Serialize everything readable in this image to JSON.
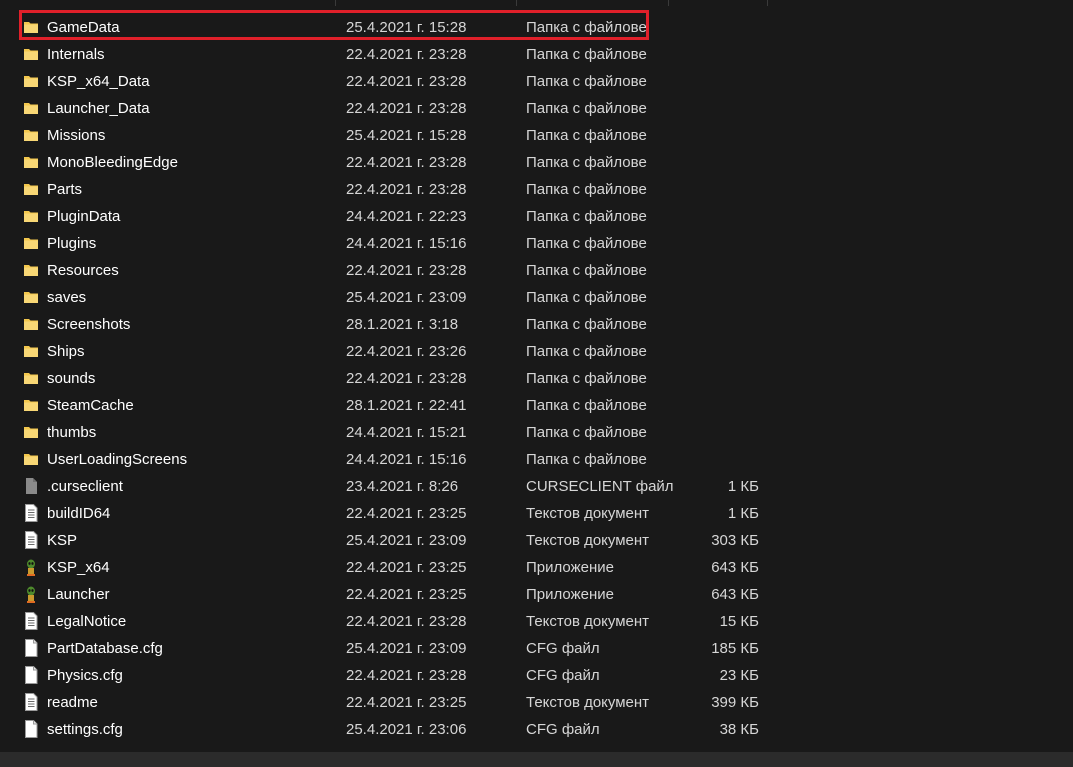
{
  "files": [
    {
      "name": "GameData",
      "date": "25.4.2021 г. 15:28",
      "type": "Папка с файлове",
      "size": "",
      "icon": "folder-icon"
    },
    {
      "name": "Internals",
      "date": "22.4.2021 г. 23:28",
      "type": "Папка с файлове",
      "size": "",
      "icon": "folder-icon"
    },
    {
      "name": "KSP_x64_Data",
      "date": "22.4.2021 г. 23:28",
      "type": "Папка с файлове",
      "size": "",
      "icon": "folder-icon"
    },
    {
      "name": "Launcher_Data",
      "date": "22.4.2021 г. 23:28",
      "type": "Папка с файлове",
      "size": "",
      "icon": "folder-icon"
    },
    {
      "name": "Missions",
      "date": "25.4.2021 г. 15:28",
      "type": "Папка с файлове",
      "size": "",
      "icon": "folder-icon"
    },
    {
      "name": "MonoBleedingEdge",
      "date": "22.4.2021 г. 23:28",
      "type": "Папка с файлове",
      "size": "",
      "icon": "folder-icon"
    },
    {
      "name": "Parts",
      "date": "22.4.2021 г. 23:28",
      "type": "Папка с файлове",
      "size": "",
      "icon": "folder-icon"
    },
    {
      "name": "PluginData",
      "date": "24.4.2021 г. 22:23",
      "type": "Папка с файлове",
      "size": "",
      "icon": "folder-icon"
    },
    {
      "name": "Plugins",
      "date": "24.4.2021 г. 15:16",
      "type": "Папка с файлове",
      "size": "",
      "icon": "folder-icon"
    },
    {
      "name": "Resources",
      "date": "22.4.2021 г. 23:28",
      "type": "Папка с файлове",
      "size": "",
      "icon": "folder-icon"
    },
    {
      "name": "saves",
      "date": "25.4.2021 г. 23:09",
      "type": "Папка с файлове",
      "size": "",
      "icon": "folder-icon"
    },
    {
      "name": "Screenshots",
      "date": "28.1.2021 г. 3:18",
      "type": "Папка с файлове",
      "size": "",
      "icon": "folder-icon"
    },
    {
      "name": "Ships",
      "date": "22.4.2021 г. 23:26",
      "type": "Папка с файлове",
      "size": "",
      "icon": "folder-icon"
    },
    {
      "name": "sounds",
      "date": "22.4.2021 г. 23:28",
      "type": "Папка с файлове",
      "size": "",
      "icon": "folder-icon"
    },
    {
      "name": "SteamCache",
      "date": "28.1.2021 г. 22:41",
      "type": "Папка с файлове",
      "size": "",
      "icon": "folder-icon"
    },
    {
      "name": "thumbs",
      "date": "24.4.2021 г. 15:21",
      "type": "Папка с файлове",
      "size": "",
      "icon": "folder-icon"
    },
    {
      "name": "UserLoadingScreens",
      "date": "24.4.2021 г. 15:16",
      "type": "Папка с файлове",
      "size": "",
      "icon": "folder-icon"
    },
    {
      "name": ".curseclient",
      "date": "23.4.2021 г. 8:26",
      "type": "CURSECLIENT файл",
      "size": "1 КБ",
      "icon": "hidden-file-icon"
    },
    {
      "name": "buildID64",
      "date": "22.4.2021 г. 23:25",
      "type": "Текстов документ",
      "size": "1 КБ",
      "icon": "text-file-icon"
    },
    {
      "name": "KSP",
      "date": "25.4.2021 г. 23:09",
      "type": "Текстов документ",
      "size": "303 КБ",
      "icon": "text-file-icon"
    },
    {
      "name": "KSP_x64",
      "date": "22.4.2021 г. 23:25",
      "type": "Приложение",
      "size": "643 КБ",
      "icon": "app-icon"
    },
    {
      "name": "Launcher",
      "date": "22.4.2021 г. 23:25",
      "type": "Приложение",
      "size": "643 КБ",
      "icon": "app-icon"
    },
    {
      "name": "LegalNotice",
      "date": "22.4.2021 г. 23:28",
      "type": "Текстов документ",
      "size": "15 КБ",
      "icon": "text-file-icon"
    },
    {
      "name": "PartDatabase.cfg",
      "date": "25.4.2021 г. 23:09",
      "type": "CFG файл",
      "size": "185 КБ",
      "icon": "file-icon"
    },
    {
      "name": "Physics.cfg",
      "date": "22.4.2021 г. 23:28",
      "type": "CFG файл",
      "size": "23 КБ",
      "icon": "file-icon"
    },
    {
      "name": "readme",
      "date": "22.4.2021 г. 23:25",
      "type": "Текстов документ",
      "size": "399 КБ",
      "icon": "text-file-icon"
    },
    {
      "name": "settings.cfg",
      "date": "25.4.2021 г. 23:06",
      "type": "CFG файл",
      "size": "38 КБ",
      "icon": "file-icon"
    }
  ],
  "highlighted_row": "GameData",
  "colors": {
    "background": "#191919",
    "highlight_border": "#e0202a",
    "folder": "#f3c74d"
  }
}
